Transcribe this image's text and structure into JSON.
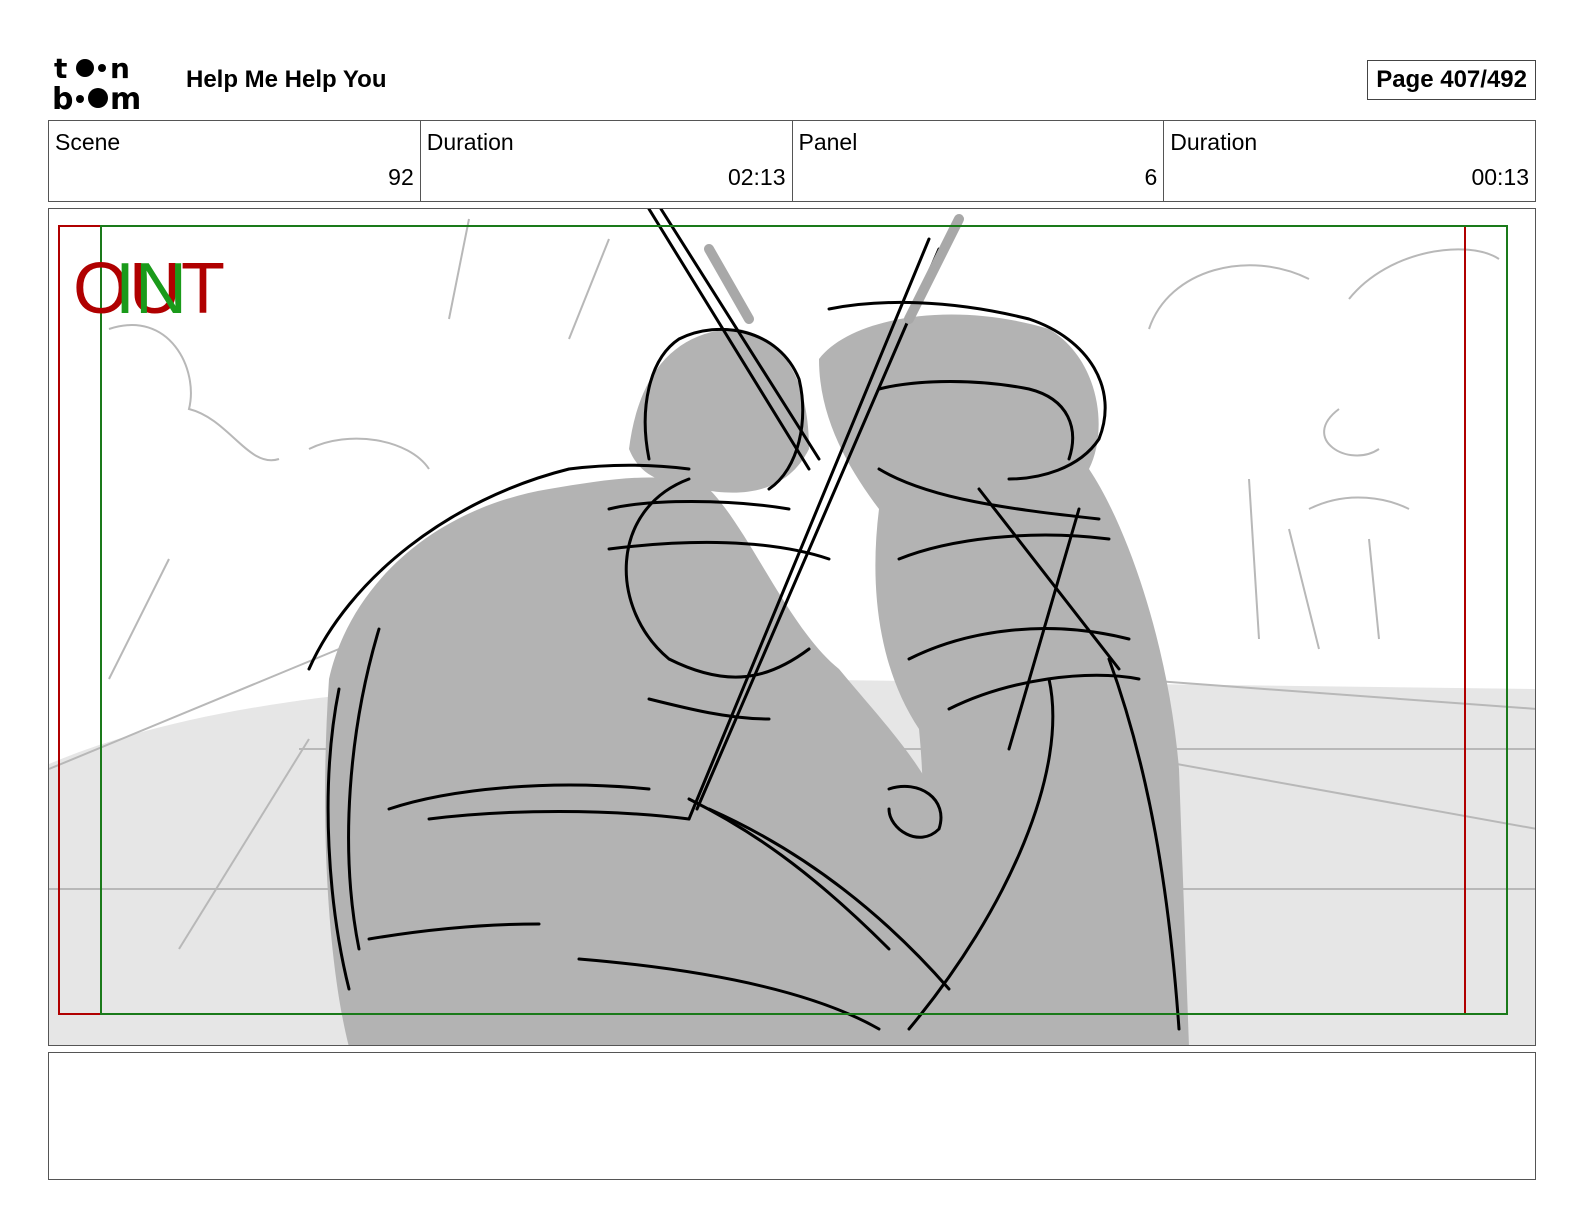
{
  "header": {
    "logo_text_top": "toon",
    "logo_text_bottom": "boom",
    "project_title": "Help Me Help You",
    "page_indicator": "Page 407/492"
  },
  "info": {
    "scene_label": "Scene",
    "scene_value": "92",
    "scene_duration_label": "Duration",
    "scene_duration_value": "02:13",
    "panel_label": "Panel",
    "panel_value": "6",
    "panel_duration_label": "Duration",
    "panel_duration_value": "00:13"
  },
  "panel": {
    "out_marker": "OUT",
    "in_marker": "IN",
    "out_color": "#b00000",
    "in_color": "#1a9a1a"
  },
  "notes": {
    "text": ""
  }
}
